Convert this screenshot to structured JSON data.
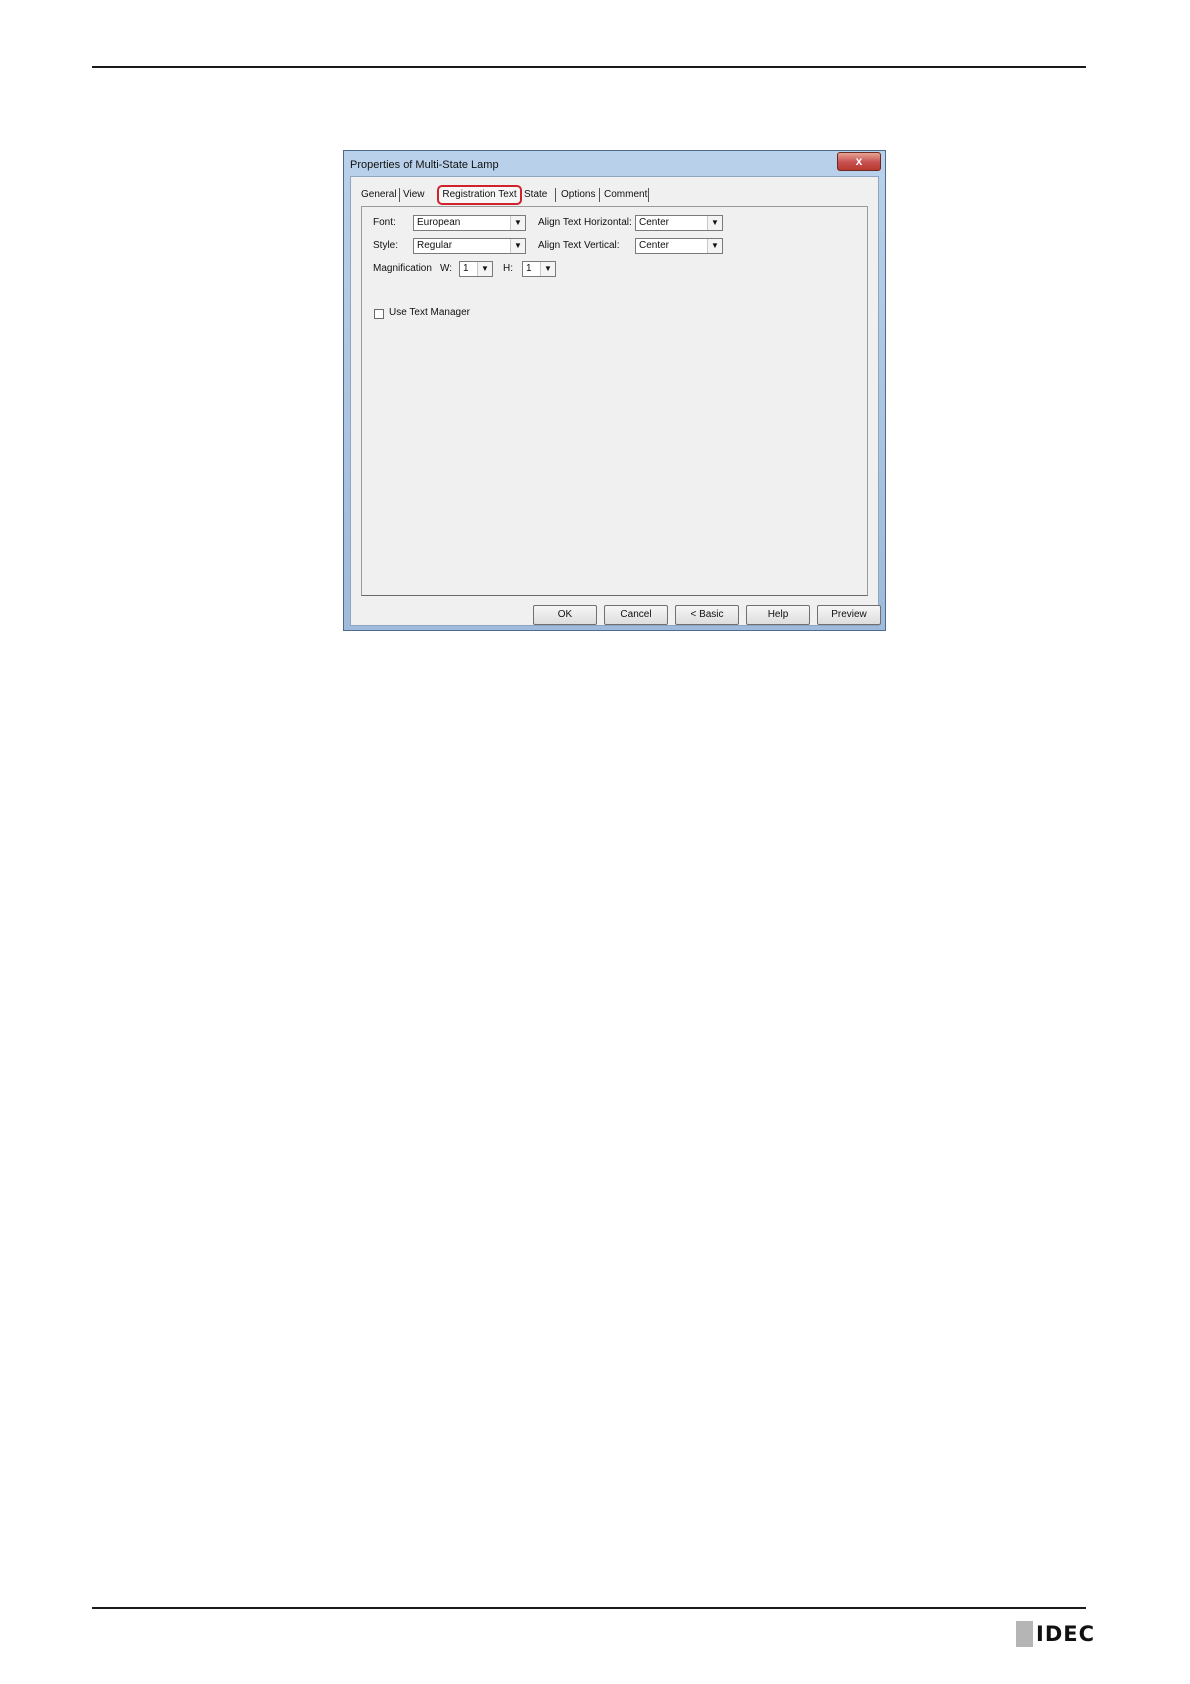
{
  "dialog": {
    "title": "Properties of Multi-State Lamp",
    "close_label": "x",
    "tabs": [
      "General",
      "View",
      "Registration Text",
      "State",
      "Options",
      "Comment"
    ],
    "active_tab": "Registration Text",
    "fields": {
      "font_label": "Font:",
      "font_value": "European",
      "style_label": "Style:",
      "style_value": "Regular",
      "magnification_label": "Magnification",
      "w_label": "W:",
      "w_value": "1",
      "h_label": "H:",
      "h_value": "1",
      "align_horizontal_label": "Align Text Horizontal:",
      "align_horizontal_value": "Center",
      "align_vertical_label": "Align Text Vertical:",
      "align_vertical_value": "Center",
      "use_text_manager_label": "Use Text Manager",
      "use_text_manager_checked": false
    },
    "buttons": [
      "OK",
      "Cancel",
      "< Basic",
      "Help",
      "Preview"
    ]
  },
  "footer": {
    "logo_text": "IDEC"
  },
  "colors": {
    "highlight": "#d0222d",
    "title_bar": "#b9d1ea",
    "close_button": "#c75050"
  }
}
